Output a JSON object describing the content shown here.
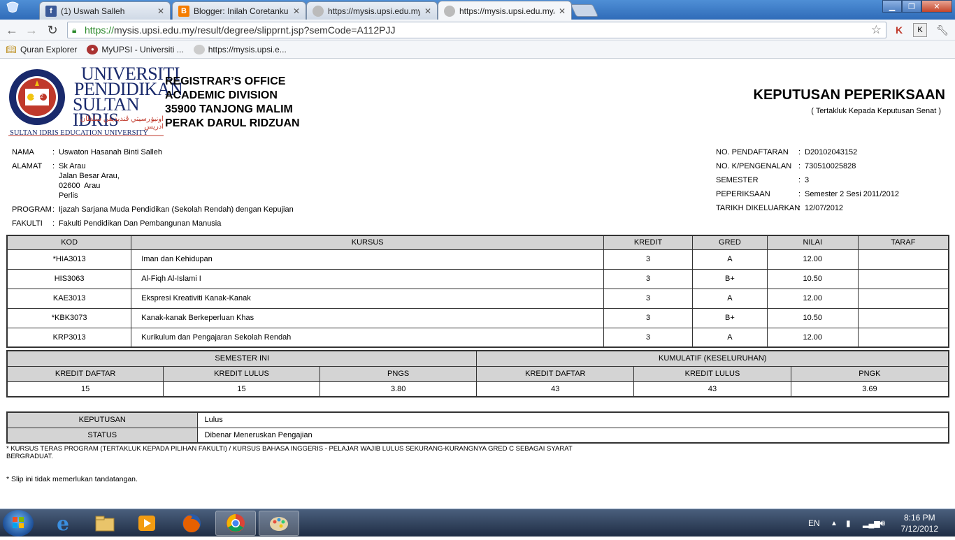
{
  "browser": {
    "tabs": [
      {
        "title": "(1) Uswah Salleh",
        "icon": "facebook-icon",
        "color": "#3b5998"
      },
      {
        "title": "Blogger: Inilah Coretanku...",
        "icon": "blogger-icon",
        "color": "#f57d00"
      },
      {
        "title": "https://mysis.upsi.edu.my/",
        "icon": "globe-icon",
        "color": "#888888"
      },
      {
        "title": "https://mysis.upsi.edu.my/",
        "icon": "globe-icon",
        "color": "#888888"
      }
    ],
    "url_scheme": "https://",
    "url_rest": "mysis.upsi.edu.my/result/degree/slipprnt.jsp?semCode=A112PJJ",
    "bookmarks": [
      {
        "label": "Quran Explorer",
        "icon": "quran-explorer-icon"
      },
      {
        "label": "MyUPSI - Universiti ...",
        "icon": "upsi-icon"
      },
      {
        "label": "https://mysis.upsi.e...",
        "icon": "globe-icon"
      }
    ]
  },
  "header": {
    "university_line1": "UNIVERSITI",
    "university_line2": "PENDIDIKAN",
    "university_line3": "SULTAN IDRIS",
    "university_en": "SULTAN IDRIS EDUCATION UNIVERSITY",
    "jawi": "اونيۏرسيتي ڤنديديقن سلطان ادريس",
    "seal_year": "1922",
    "address_lines": [
      "REGISTRAR’S OFFICE",
      "ACADEMIC DIVISION",
      "35900 TANJONG MALIM",
      "PERAK DARUL RIDZUAN"
    ],
    "title": "KEPUTUSAN PEPERIKSAAN",
    "subtitle": "( Tertakluk Kepada Keputusan Senat )"
  },
  "student": {
    "nama_label": "NAMA",
    "nama": "Uswaton Hasanah Binti Salleh",
    "alamat_label": "ALAMAT",
    "alamat": [
      "Sk Arau",
      "Jalan Besar Arau,",
      "02600  Arau",
      "Perlis"
    ],
    "program_label": "PROGRAM",
    "program": "Ijazah Sarjana Muda Pendidikan (Sekolah Rendah) dengan Kepujian",
    "fakulti_label": "FAKULTI",
    "fakulti": "Fakulti Pendidikan Dan Pembangunan Manusia"
  },
  "registration": {
    "no_pendaftaran_label": "NO. PENDAFTARAN",
    "no_pendaftaran": "D20102043152",
    "no_kp_label": "NO. K/PENGENALAN",
    "no_kp": "730510025828",
    "semester_label": "SEMESTER",
    "semester": "3",
    "peperiksaan_label": "PEPERIKSAAN",
    "peperiksaan": "Semester 2 Sesi 2011/2012",
    "tarikh_label": "TARIKH DIKELUARKAN",
    "tarikh": "12/07/2012"
  },
  "courses": {
    "headers": [
      "KOD",
      "KURSUS",
      "KREDIT",
      "GRED",
      "NILAI",
      "TARAF"
    ],
    "rows": [
      {
        "kod": "*HIA3013",
        "kursus": "Iman dan Kehidupan",
        "kredit": "3",
        "gred": "A",
        "nilai": "12.00",
        "taraf": ""
      },
      {
        "kod": "HIS3063",
        "kursus": "Al-Fiqh Al-Islami I",
        "kredit": "3",
        "gred": "B+",
        "nilai": "10.50",
        "taraf": ""
      },
      {
        "kod": "KAE3013",
        "kursus": "Ekspresi Kreativiti Kanak-Kanak",
        "kredit": "3",
        "gred": "A",
        "nilai": "12.00",
        "taraf": ""
      },
      {
        "kod": "*KBK3073",
        "kursus": "Kanak-kanak Berkeperluan Khas",
        "kredit": "3",
        "gred": "B+",
        "nilai": "10.50",
        "taraf": ""
      },
      {
        "kod": "KRP3013",
        "kursus": "Kurikulum dan Pengajaran Sekolah Rendah",
        "kredit": "3",
        "gred": "A",
        "nilai": "12.00",
        "taraf": ""
      }
    ]
  },
  "summary": {
    "semester_label": "SEMESTER INI",
    "kumulatif_label": "KUMULATIF (KESELURUHAN)",
    "headers": [
      "KREDIT DAFTAR",
      "KREDIT LULUS",
      "PNGS",
      "KREDIT DAFTAR",
      "KREDIT LULUS",
      "PNGK"
    ],
    "values": [
      "15",
      "15",
      "3.80",
      "43",
      "43",
      "3.69"
    ]
  },
  "decision": {
    "keputusan_label": "KEPUTUSAN",
    "keputusan": "Lulus",
    "status_label": "STATUS",
    "status": "Dibenar Meneruskan Pengajian"
  },
  "notes": {
    "note1_line1": "* KURSUS TERAS PROGRAM (TERTAKLUK KEPADA PILIHAN FAKULTI) / KURSUS BAHASA INGGERIS - PELAJAR WAJIB LULUS SEKURANG-KURANGNYA GRED C SEBAGAI SYARAT",
    "note1_line2": "BERGRADUAT.",
    "note2": "* Slip ini tidak memerlukan tandatangan."
  },
  "taskbar": {
    "language": "EN",
    "time": "8:16 PM",
    "date": "7/12/2012",
    "apps": [
      "internet-explorer-icon",
      "windows-explorer-icon",
      "media-player-icon",
      "firefox-icon",
      "chrome-icon",
      "paint-icon"
    ]
  }
}
